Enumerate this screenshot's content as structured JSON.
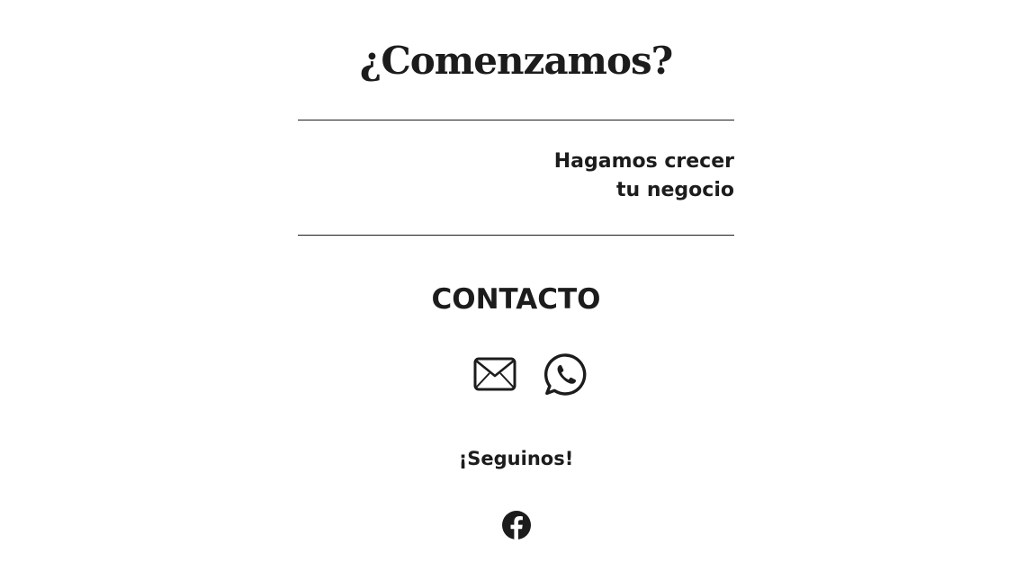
{
  "hero": {
    "title": "¿Comenzamos?"
  },
  "tagline": {
    "line1": "Hagamos crecer",
    "line2": "tu negocio"
  },
  "contact": {
    "title": "CONTACTO",
    "icons": [
      "envelope-icon",
      "whatsapp-icon"
    ]
  },
  "follow": {
    "title": "¡Seguinos!",
    "icons": [
      "facebook-icon"
    ]
  },
  "colors": {
    "text": "#1c1c1c",
    "background": "#ffffff"
  }
}
